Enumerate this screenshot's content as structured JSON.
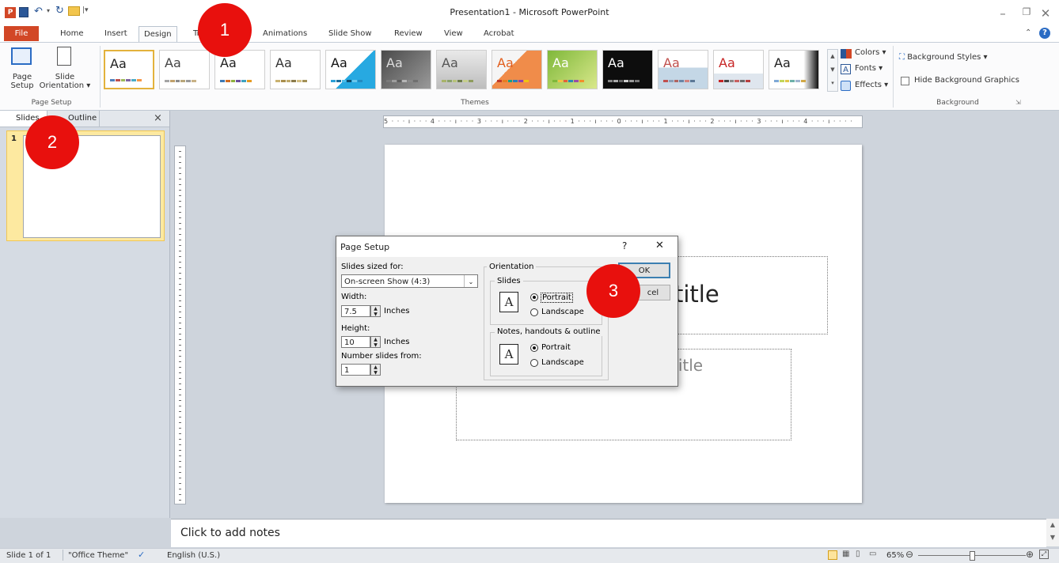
{
  "window": {
    "title": "Presentation1 - Microsoft PowerPoint",
    "buttons": [
      "–",
      "❐",
      "✕"
    ]
  },
  "ribbon_tabs": [
    "File",
    "Home",
    "Insert",
    "Design",
    "Transitions",
    "Animations",
    "Slide Show",
    "Review",
    "View",
    "Acrobat"
  ],
  "ribbon": {
    "page_setup_btn": "Page Setup",
    "page_setup_line1": "Page",
    "page_setup_line2": "Setup",
    "orientation_line1": "Slide",
    "orientation_line2": "Orientation",
    "group_page_setup": "Page Setup",
    "group_themes": "Themes",
    "group_background": "Background",
    "colors": "Colors",
    "fonts": "Fonts",
    "effects": "Effects",
    "background_styles": "Background Styles",
    "hide_background_graphics": "Hide Background Graphics",
    "theme_sample": "Aa"
  },
  "left_pane": {
    "tab_slides": "Slides",
    "tab_outline": "Outline",
    "close": "×",
    "slide_number": "1"
  },
  "ruler": {
    "horizontal": "5 · · · ı · · · 4 · · · ı · · · 3 · · · ı · · · 2 · · · ı · · · 1 · · · ı · · · 0 · · · ı · · · 1 · · · ı · · · 2 · · · ı · · · 3 · · · ı · · · 4 · · · ı · · · ·"
  },
  "slide": {
    "title_placeholder_visible": "title",
    "subtitle_placeholder_visible": "title"
  },
  "notes": {
    "placeholder": "Click to add notes"
  },
  "status_bar": {
    "slide_info": "Slide 1 of 1",
    "theme": "\"Office Theme\"",
    "language": "English (U.S.)",
    "zoom": "65%"
  },
  "dialog": {
    "title": "Page Setup",
    "help": "?",
    "close": "✕",
    "slides_sized_for_label": "Slides sized for:",
    "slides_sized_for_value": "On-screen Show (4:3)",
    "width_label": "Width:",
    "width_value": "7.5",
    "height_label": "Height:",
    "height_value": "10",
    "inches": "Inches",
    "number_slides_from_label": "Number slides from:",
    "number_slides_from_value": "1",
    "orientation_label": "Orientation",
    "slides_group_label": "Slides",
    "notes_group_label": "Notes, handouts & outline",
    "portrait": "Portrait",
    "landscape": "Landscape",
    "ok": "OK",
    "cancel": "Cancel",
    "cancel_visible": "cel"
  },
  "annotations": [
    "1",
    "2",
    "3"
  ]
}
